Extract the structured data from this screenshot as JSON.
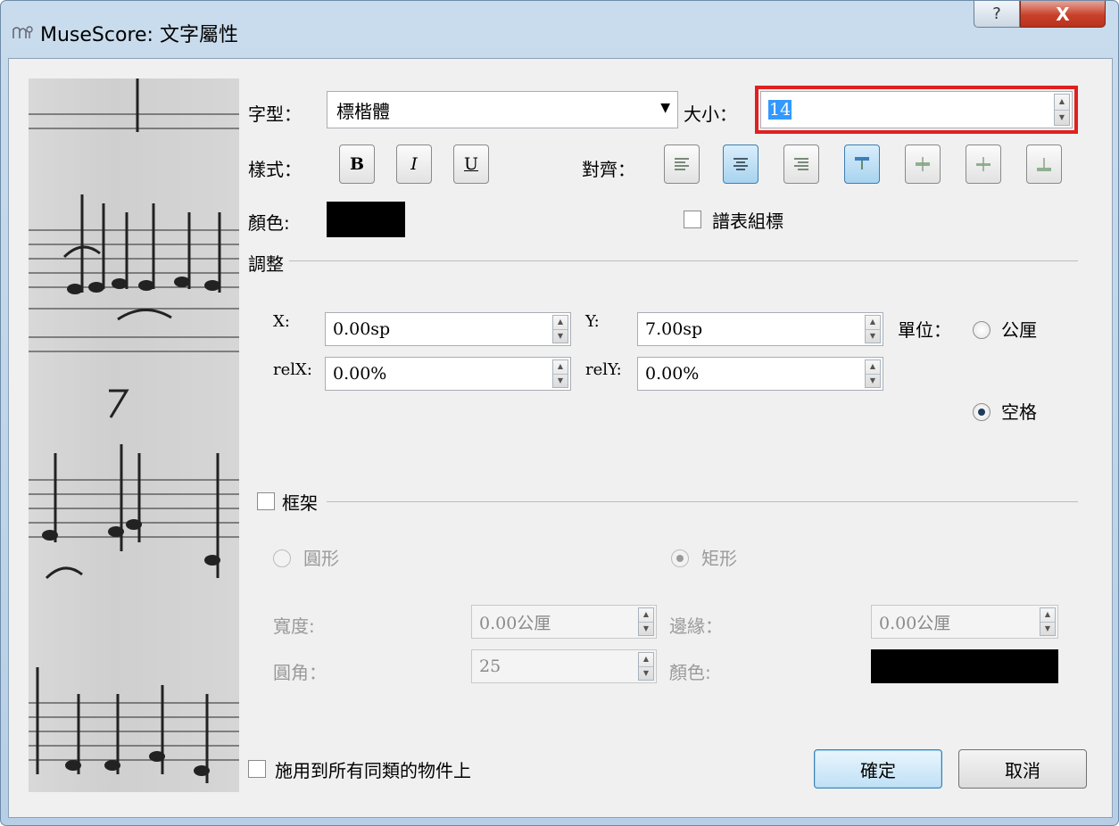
{
  "window": {
    "title": "MuseScore: 文字屬性",
    "app_icon": "musescore-icon",
    "help_label": "?",
    "close_label": "X"
  },
  "font": {
    "face_label": "字型：",
    "face_value": "標楷體",
    "size_label": "大小：",
    "size_value": "14"
  },
  "style": {
    "label": "樣式：",
    "bold": "B",
    "italic": "I",
    "underline": "U"
  },
  "align": {
    "label": "對齊：",
    "buttons": [
      "align-left",
      "align-center",
      "align-right",
      "valign-top",
      "valign-center",
      "valign-baseline",
      "valign-bottom"
    ],
    "active": [
      "align-center",
      "valign-top"
    ]
  },
  "color": {
    "label": "顏色:",
    "value": "#000000"
  },
  "system_flag": {
    "label": "譜表組標",
    "checked": false
  },
  "offset": {
    "section_label": "調整",
    "x_label": "X:",
    "x_value": "0.00sp",
    "y_label": "Y:",
    "y_value": "7.00sp",
    "relx_label": "relX:",
    "relx_value": "0.00%",
    "rely_label": "relY:",
    "rely_value": "0.00%",
    "unit_label": "單位：",
    "unit_mm": "公厘",
    "unit_space": "空格",
    "unit_selected": "空格"
  },
  "frame": {
    "section_label": "框架",
    "checked": false,
    "circle_label": "圓形",
    "box_label": "矩形",
    "shape_selected": "矩形",
    "width_label": "寬度:",
    "width_value": "0.00公厘",
    "margin_label": "邊緣：",
    "margin_value": "0.00公厘",
    "round_label": "圓角：",
    "round_value": "25",
    "color_label": "顏色:",
    "color_value": "#000000"
  },
  "apply_all": {
    "label": "施用到所有同類的物件上",
    "checked": false
  },
  "buttons": {
    "ok": "確定",
    "cancel": "取消"
  }
}
